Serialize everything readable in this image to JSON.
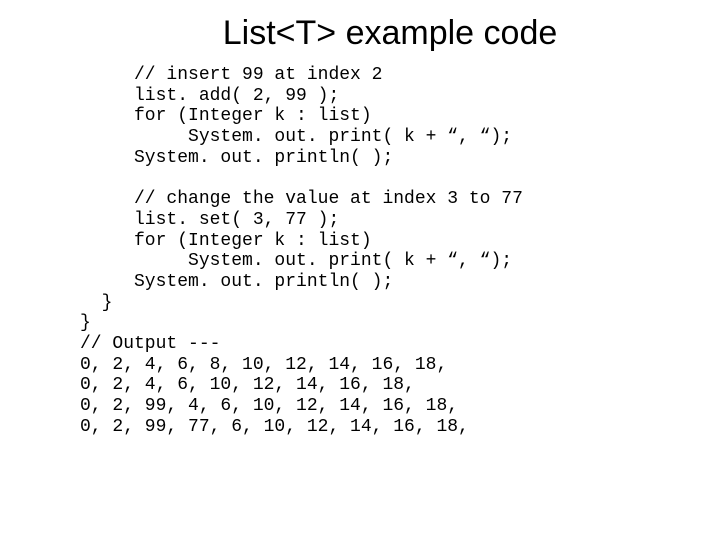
{
  "title": "List<T> example code",
  "code_lines": [
    "     // insert 99 at index 2",
    "     list. add( 2, 99 );",
    "     for (Integer k : list)",
    "          System. out. print( k + “, “);",
    "     System. out. println( );",
    "",
    "     // change the value at index 3 to 77",
    "     list. set( 3, 77 );",
    "     for (Integer k : list)",
    "          System. out. print( k + “, “);",
    "     System. out. println( );",
    "  }",
    "}",
    "// Output ---",
    "0, 2, 4, 6, 8, 10, 12, 14, 16, 18,",
    "0, 2, 4, 6, 10, 12, 14, 16, 18,",
    "0, 2, 99, 4, 6, 10, 12, 14, 16, 18,",
    "0, 2, 99, 77, 6, 10, 12, 14, 16, 18,"
  ]
}
